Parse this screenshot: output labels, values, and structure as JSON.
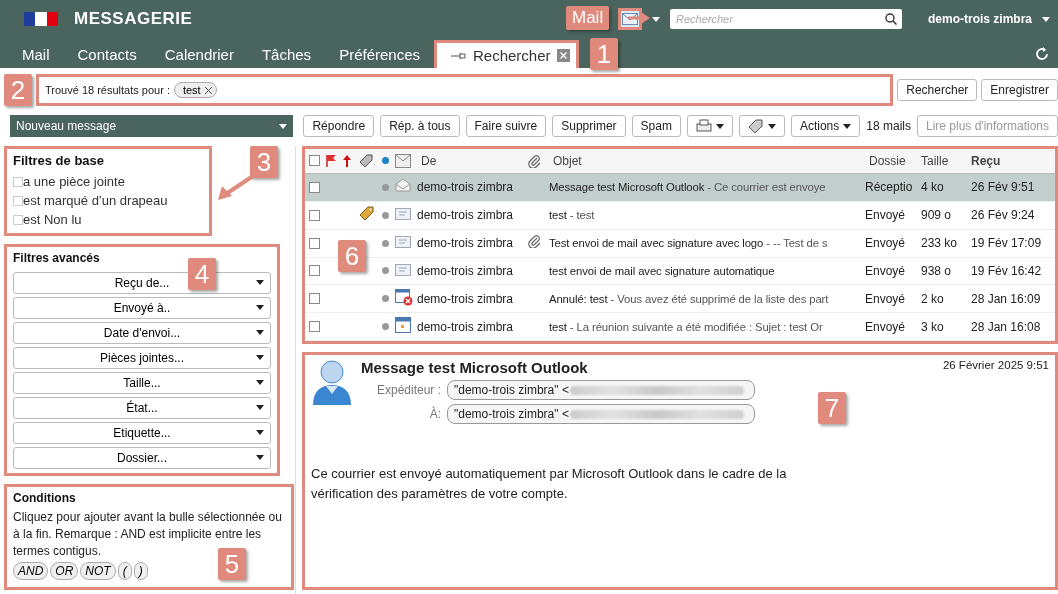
{
  "header": {
    "title": "MESSAGERIE",
    "search_placeholder": "Rechercher",
    "user": "demo-trois zimbra"
  },
  "tabs": [
    {
      "label": "Mail",
      "selected": false,
      "kind": "app"
    },
    {
      "label": "Contacts",
      "selected": false,
      "kind": "app"
    },
    {
      "label": "Calendrier",
      "selected": false,
      "kind": "app"
    },
    {
      "label": "Tâches",
      "selected": false,
      "kind": "app"
    },
    {
      "label": "Préférences",
      "selected": false,
      "kind": "app"
    },
    {
      "label": "Rechercher",
      "selected": true,
      "kind": "search"
    }
  ],
  "search_bar": {
    "summary": "Trouvé 18 résultats pour :",
    "chips": [
      "test"
    ],
    "buttons": [
      "Rechercher",
      "Enregistrer"
    ]
  },
  "toolbar": {
    "new_message": "Nouveau message",
    "buttons": [
      "Répondre",
      "Rép. à tous",
      "Faire suivre",
      "Supprimer",
      "Spam"
    ],
    "actions": "Actions",
    "count": "18 mails",
    "more": {
      "label": "Lire plus d'informations",
      "disabled": true
    }
  },
  "basic_filters": {
    "title": "Filtres de base",
    "items": [
      {
        "label": "a une pièce jointe",
        "checked": false
      },
      {
        "label": "est marqué d’un drapeau",
        "checked": false
      },
      {
        "label": "est Non lu",
        "checked": false
      }
    ]
  },
  "advanced_filters": {
    "title": "Filtres avancés",
    "items": [
      "Reçu de...",
      "Envoyé à..",
      "Date d'envoi...",
      "Pièces jointes...",
      "Taille...",
      "État...",
      "Etiquette...",
      "Dossier..."
    ]
  },
  "conditions": {
    "title": "Conditions",
    "text": "Cliquez pour ajouter avant la bulle sélectionnée ou à la fin. Remarque : AND est implicite entre les termes contigus.",
    "operators": [
      "AND",
      "OR",
      "NOT",
      "(",
      ")"
    ]
  },
  "message_list": {
    "all_checked": false,
    "columns": [
      "De",
      "Objet",
      "Dossie",
      "Taille",
      "Reçu"
    ],
    "rows": [
      {
        "selected": true,
        "checked": false,
        "tagged": false,
        "unread": false,
        "kind": "received",
        "from": "demo-trois zimbra",
        "attachment": false,
        "subject": "Message test Microsoft Outlook",
        "fragment": "- Ce courrier est envoye",
        "folder": "Réceptio",
        "size": "4 ko",
        "date": "26 Fév 9:51"
      },
      {
        "selected": false,
        "checked": false,
        "tagged": true,
        "unread": false,
        "kind": "sent",
        "from": "demo-trois zimbra",
        "attachment": false,
        "subject": "test",
        "fragment": "- test",
        "folder": "Envoyé",
        "size": "909 o",
        "date": "26 Fév 9:24"
      },
      {
        "selected": false,
        "checked": false,
        "tagged": false,
        "unread": false,
        "kind": "sent",
        "from": "demo-trois zimbra",
        "attachment": true,
        "subject": "Test envoi de mail avec signature avec logo",
        "fragment": "- -- Test de s",
        "folder": "Envoyé",
        "size": "233 ko",
        "date": "19 Fév 17:09"
      },
      {
        "selected": false,
        "checked": false,
        "tagged": false,
        "unread": false,
        "kind": "sent",
        "from": "demo-trois zimbra",
        "attachment": false,
        "subject": "test envoi de mail avec signature automatique",
        "folder": "Envoyé",
        "size": "938 o",
        "date": "19 Fév 16:42"
      },
      {
        "selected": false,
        "checked": false,
        "tagged": false,
        "unread": false,
        "kind": "cancelled",
        "from": "demo-trois zimbra",
        "attachment": false,
        "subject": "Annulé: test",
        "fragment": "- Vous avez été supprimé de la liste des part",
        "folder": "Envoyé",
        "size": "2 ko",
        "date": "28 Jan 16:09"
      },
      {
        "selected": false,
        "checked": false,
        "tagged": false,
        "unread": false,
        "kind": "meeting",
        "from": "demo-trois zimbra",
        "attachment": false,
        "subject": "test",
        "fragment": "- La réunion suivante a été modifiée : Sujet : test Or",
        "folder": "Envoyé",
        "size": "3 ko",
        "date": "28 Jan 16:08"
      }
    ]
  },
  "reading_pane": {
    "subject": "Message test Microsoft Outlook",
    "date": "26 Février 2025 9:51",
    "fields": [
      {
        "label": "Expéditeur :",
        "value": "\"demo-trois zimbra\" <"
      },
      {
        "label": "À:",
        "value": "\"demo-trois zimbra\" <"
      }
    ],
    "body": "Ce courrier est envoyé automatiquement par Microsoft Outlook dans le cadre de la vérification des paramètres de votre compte."
  },
  "annotations": {
    "callout": "Mail",
    "badges": [
      "1",
      "2",
      "3",
      "4",
      "5",
      "6",
      "7"
    ]
  }
}
